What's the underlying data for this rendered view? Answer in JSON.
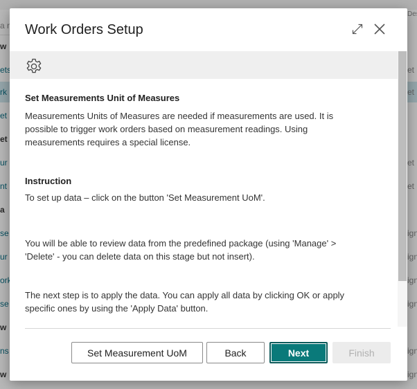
{
  "dialog": {
    "title": "Work Orders Setup",
    "section1": {
      "heading": "Set Measurements Unit of Measures",
      "line1": "Measurements Units of Measures are needed if measurements are used. It is",
      "line2": "possible to trigger work orders based on measurement readings. Using",
      "line3": "measurements requires a special license."
    },
    "section2": {
      "heading": "Instruction",
      "line1": "To set up data – click on the button 'Set Measurement UoM'."
    },
    "section3": {
      "line1": "You will be able to review data from the predefined package (using 'Manage' >",
      "line2": "'Delete' - you can delete data on this stage but not insert)."
    },
    "section4": {
      "line1": "The next step is to apply the data. You can apply all data by clicking OK or apply",
      "line2": "specific ones by using the 'Apply Data' button."
    },
    "buttons": {
      "set_uom": "Set Measurement UoM",
      "back": "Back",
      "next": "Next",
      "finish": "Finish"
    }
  },
  "background": {
    "left": [
      "a n",
      "w",
      "ets",
      "rk",
      "et",
      "et",
      "ur",
      "nt",
      "a",
      "se",
      "ur",
      "ork",
      "se",
      "w",
      "ns",
      "w"
    ],
    "right": [
      "Descr",
      "et u",
      "et u",
      "et u",
      "et u",
      "ign",
      "ign",
      "ign",
      "ign",
      "ign",
      "ign"
    ]
  },
  "colors": {
    "accent": "#0a7a7a",
    "link": "#0a6f86"
  }
}
